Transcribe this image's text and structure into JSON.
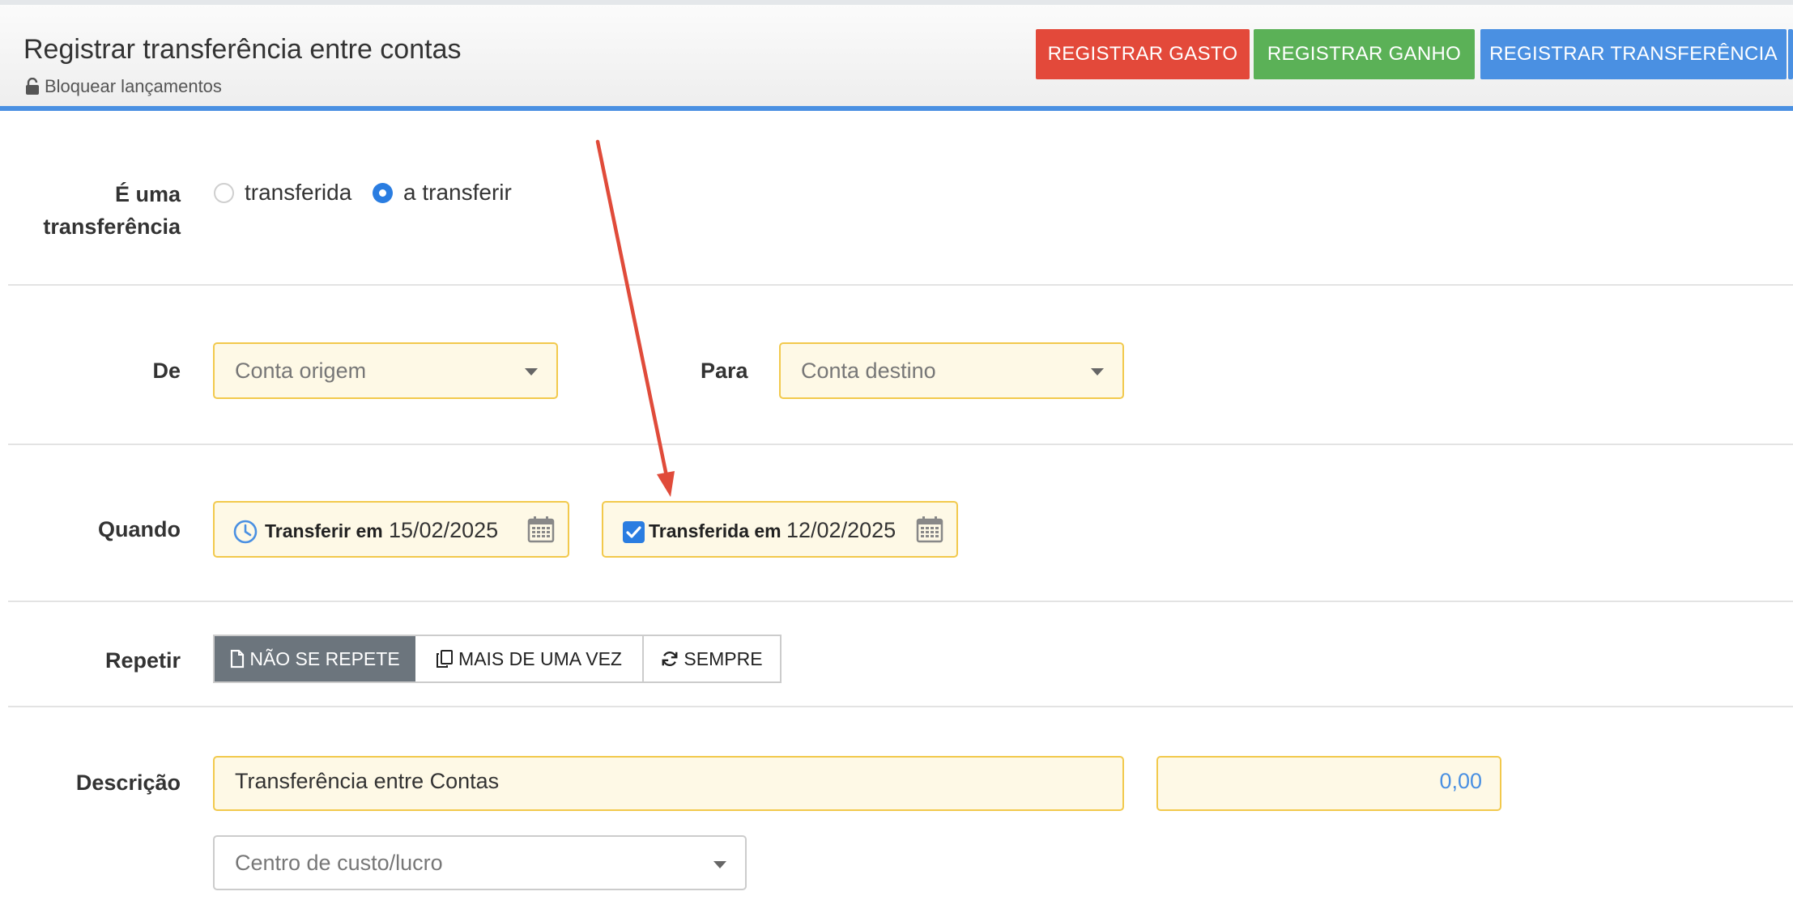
{
  "header": {
    "title": "Registrar transferência entre contas",
    "lock_label": "Bloquear lançamentos",
    "buttons": {
      "expense": "REGISTRAR GASTO",
      "income": "REGISTRAR GANHO",
      "transfer": "REGISTRAR TRANSFERÊNCIA"
    },
    "colors": {
      "expense": "#e3493a",
      "income": "#5bb157",
      "transfer": "#4a90e2"
    }
  },
  "form": {
    "status": {
      "label_line1": "É uma",
      "label_line2": "transferência",
      "options": [
        "transferida",
        "a transferir"
      ],
      "selected": "a transferir"
    },
    "accounts": {
      "from_label": "De",
      "from_placeholder": "Conta origem",
      "to_label": "Para",
      "to_placeholder": "Conta destino"
    },
    "when": {
      "label": "Quando",
      "scheduled_label": "Transferir em",
      "scheduled_date": "15/02/2025",
      "done_label": "Transferida em",
      "done_date": "12/02/2025",
      "done_checked": true
    },
    "repeat": {
      "label": "Repetir",
      "options": [
        "NÃO SE REPETE",
        "MAIS DE UMA VEZ",
        "SEMPRE"
      ],
      "selected": "NÃO SE REPETE"
    },
    "description": {
      "label": "Descrição",
      "value": "Transferência entre Contas",
      "amount": "0,00",
      "cost_center_placeholder": "Centro de custo/lucro"
    }
  },
  "annotation": {
    "arrow_color": "#e04b3a"
  }
}
